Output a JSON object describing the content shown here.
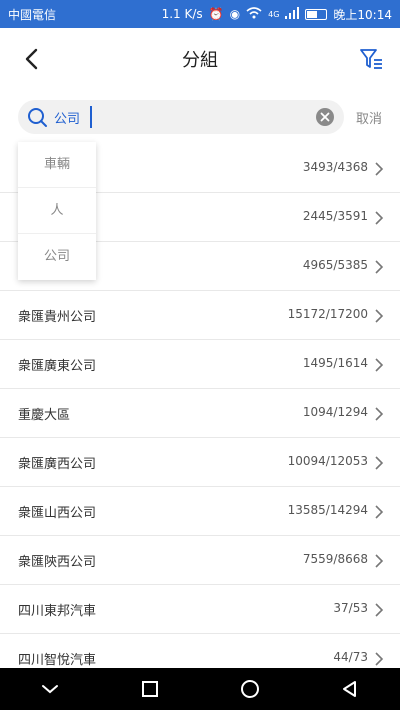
{
  "status_bar": {
    "carrier": "中國電信",
    "speed": "1.1 K/s",
    "network": "4G",
    "time": "晚上10:14",
    "battery_level": 0.55
  },
  "header": {
    "title": "分組"
  },
  "search": {
    "value": "公司",
    "cancel_label": "取消"
  },
  "dropdown": {
    "options": [
      "車輛",
      "人",
      "公司"
    ]
  },
  "rows": [
    {
      "label": "",
      "count": "3493/4368"
    },
    {
      "label": "",
      "count": "2445/3591"
    },
    {
      "label": "",
      "count": "4965/5385"
    },
    {
      "label": "衆匯貴州公司",
      "count": "15172/17200"
    },
    {
      "label": "衆匯廣東公司",
      "count": "1495/1614"
    },
    {
      "label": "重慶大區",
      "count": "1094/1294"
    },
    {
      "label": "衆匯廣西公司",
      "count": "10094/12053"
    },
    {
      "label": "衆匯山西公司",
      "count": "13585/14294"
    },
    {
      "label": "衆匯陝西公司",
      "count": "7559/8668"
    },
    {
      "label": "四川東邦汽車",
      "count": "37/53"
    },
    {
      "label": "四川智悅汽車",
      "count": "44/73"
    }
  ],
  "colors": {
    "status_bar": "#2f6fd0",
    "accent": "#1f5fd0",
    "nav_bar": "#000000"
  }
}
